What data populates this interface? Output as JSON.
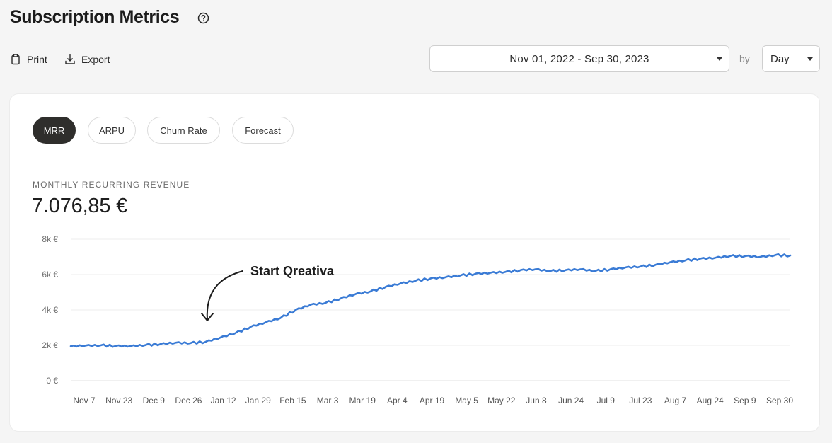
{
  "header": {
    "title": "Subscription Metrics",
    "help_icon": "question-circle-icon"
  },
  "toolbar": {
    "print_label": "Print",
    "print_icon": "clipboard-icon",
    "export_label": "Export",
    "export_icon": "download-icon",
    "date_range": "Nov 01, 2022 - Sep 30, 2023",
    "by_label": "by",
    "granularity": "Day"
  },
  "tabs": [
    {
      "label": "MRR",
      "active": true
    },
    {
      "label": "ARPU",
      "active": false
    },
    {
      "label": "Churn Rate",
      "active": false
    },
    {
      "label": "Forecast",
      "active": false
    }
  ],
  "metric": {
    "label": "MONTHLY RECURRING REVENUE",
    "value": "7.076,85 €"
  },
  "colors": {
    "line": "#3a7bd5",
    "active_tab": "#2f2e2c"
  },
  "chart_data": {
    "type": "line",
    "title": "",
    "xlabel": "",
    "ylabel": "",
    "ylim": [
      0,
      8000
    ],
    "y_ticks": [
      "0 €",
      "2k €",
      "4k €",
      "6k €",
      "8k €"
    ],
    "x_ticks": [
      "Nov 7",
      "Nov 23",
      "Dec 9",
      "Dec 26",
      "Jan 12",
      "Jan 29",
      "Feb 15",
      "Mar 3",
      "Mar 19",
      "Apr 4",
      "Apr 19",
      "May 5",
      "May 22",
      "Jun 8",
      "Jun 24",
      "Jul 9",
      "Jul 23",
      "Aug 7",
      "Aug 24",
      "Sep 9",
      "Sep 30"
    ],
    "grid": true,
    "annotation": {
      "text": "Start Qreativa",
      "x": "Jan 5"
    },
    "series": [
      {
        "x": [
          "Nov 1",
          "Nov 8",
          "Nov 15",
          "Nov 22",
          "Nov 29",
          "Dec 6",
          "Dec 13",
          "Dec 20",
          "Dec 27",
          "Jan 3",
          "Jan 10",
          "Jan 17",
          "Jan 24",
          "Jan 31",
          "Feb 7",
          "Feb 14",
          "Feb 21",
          "Feb 28",
          "Mar 7",
          "Mar 14",
          "Mar 21",
          "Mar 28",
          "Apr 4",
          "Apr 11",
          "Apr 18",
          "Apr 25",
          "May 2",
          "May 9",
          "May 16",
          "May 23",
          "May 30",
          "Jun 6",
          "Jun 13",
          "Jun 20",
          "Jun 27",
          "Jul 4",
          "Jul 11",
          "Jul 18",
          "Jul 25",
          "Aug 1",
          "Aug 8",
          "Aug 15",
          "Aug 22",
          "Aug 29",
          "Sep 5",
          "Sep 12",
          "Sep 19",
          "Sep 26",
          "Sep 30"
        ],
        "values": [
          1950,
          1990,
          2000,
          1970,
          1960,
          2020,
          2080,
          2150,
          2130,
          2200,
          2450,
          2700,
          3050,
          3300,
          3550,
          4000,
          4300,
          4400,
          4650,
          4900,
          5050,
          5300,
          5500,
          5650,
          5780,
          5850,
          5950,
          6050,
          6100,
          6150,
          6250,
          6300,
          6200,
          6250,
          6300,
          6200,
          6300,
          6400,
          6450,
          6550,
          6700,
          6800,
          6900,
          6950,
          7050,
          7050,
          7000,
          7100,
          7080
        ]
      }
    ]
  }
}
